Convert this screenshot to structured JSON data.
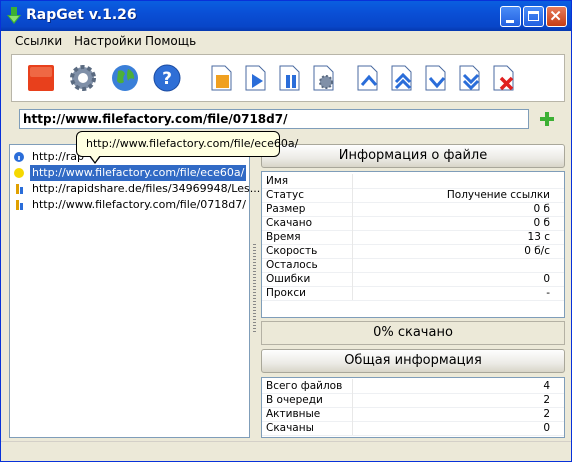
{
  "window": {
    "title": "RapGet v.1.26"
  },
  "menu": [
    "Ссылки",
    "Настройки",
    "Помощь"
  ],
  "toolbar": {
    "buttons": [
      "stop-all-icon",
      "settings-gear-icon",
      "globe-icon",
      "help-icon",
      "file-open-icon",
      "start-icon",
      "pause-icon",
      "file-settings-icon",
      "move-top-icon",
      "move-up-fast-icon",
      "move-down-icon",
      "move-bottom-icon",
      "delete-icon"
    ]
  },
  "url_input": {
    "value": "http://www.filefactory.com/file/0718d7/"
  },
  "tooltip": {
    "text": "http://www.filefactory.com/file/ece60a/"
  },
  "downloads": [
    {
      "text": "http://rapidshare.de/files/...",
      "visible_text": "http://rap",
      "icon": "info-icon",
      "color": "#2a6dd9"
    },
    {
      "text": "http://www.filefactory.com/file/ece60a/",
      "icon": "yellow-dot-icon",
      "color": "#f5d800",
      "selected": true
    },
    {
      "text": "http://rapidshare.de/files/34969948/Les...",
      "icon": "queue-arrow-icon",
      "color": "#e0a000"
    },
    {
      "text": "http://www.filefactory.com/file/0718d7/",
      "icon": "queue-arrow-icon",
      "color": "#e0a000"
    }
  ],
  "file_info": {
    "header": "Информация о файле",
    "rows": [
      {
        "key": "Имя",
        "value": ""
      },
      {
        "key": "Статус",
        "value": "Получение ссылки"
      },
      {
        "key": "Размер",
        "value": "0 б"
      },
      {
        "key": "Скачано",
        "value": "0 б"
      },
      {
        "key": "Время",
        "value": "13 с"
      },
      {
        "key": "Скорость",
        "value": "0 б/с"
      },
      {
        "key": "Осталось",
        "value": ""
      },
      {
        "key": "Ошибки",
        "value": "0"
      },
      {
        "key": "Прокси",
        "value": "-"
      }
    ]
  },
  "progress": {
    "label": "0% скачано",
    "percent": 0
  },
  "summary": {
    "header": "Общая информация",
    "rows": [
      {
        "key": "Всего файлов",
        "value": "4"
      },
      {
        "key": "В очереди",
        "value": "2"
      },
      {
        "key": "Активные",
        "value": "2"
      },
      {
        "key": "Скачаны",
        "value": "0"
      }
    ]
  },
  "colors": {
    "titlebar": "#0a4fd6",
    "selection": "#316ac5",
    "tooltip_bg": "#ffffe1"
  }
}
